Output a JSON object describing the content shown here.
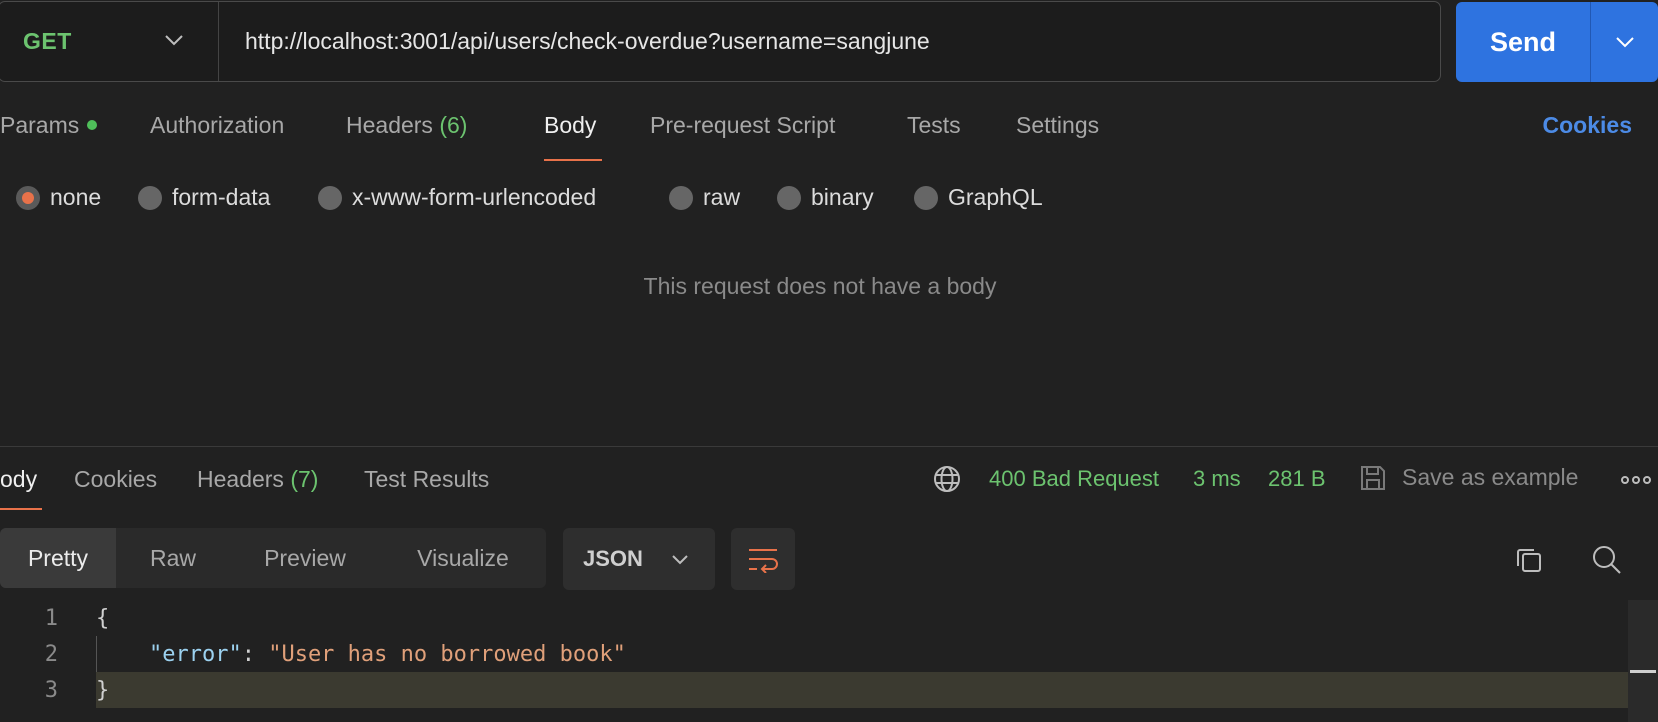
{
  "request": {
    "method": "GET",
    "url": "http://localhost:3001/api/users/check-overdue?username=sangjune",
    "send_label": "Send"
  },
  "request_tabs": {
    "params": "Params",
    "authorization": "Authorization",
    "headers": "Headers",
    "headers_count": "(6)",
    "body": "Body",
    "pre_request": "Pre-request Script",
    "tests": "Tests",
    "settings": "Settings",
    "cookies": "Cookies"
  },
  "body_types": {
    "none": "none",
    "form_data": "form-data",
    "urlencoded": "x-www-form-urlencoded",
    "raw": "raw",
    "binary": "binary",
    "graphql": "GraphQL",
    "selected": "none"
  },
  "empty_body_message": "This request does not have a body",
  "response_tabs": {
    "body": "ody",
    "cookies": "Cookies",
    "headers": "Headers",
    "headers_count": "(7)",
    "test_results": "Test Results"
  },
  "response_status": {
    "status": "400 Bad Request",
    "time": "3 ms",
    "size": "281 B",
    "save_example": "Save as example"
  },
  "view_modes": {
    "pretty": "Pretty",
    "raw": "Raw",
    "preview": "Preview",
    "visualize": "Visualize",
    "format": "JSON"
  },
  "code": {
    "line1_num": "1",
    "line1": "{",
    "line2_num": "2",
    "line2_indent": "    ",
    "line2_key": "\"error\"",
    "line2_sep": ": ",
    "line2_value": "\"User has no borrowed book\"",
    "line3_num": "3",
    "line3": "}"
  },
  "colors": {
    "accent_orange": "#e8724a",
    "send_blue": "#2e73e0",
    "status_green": "#6cc36f",
    "link_blue": "#4c8be6"
  }
}
